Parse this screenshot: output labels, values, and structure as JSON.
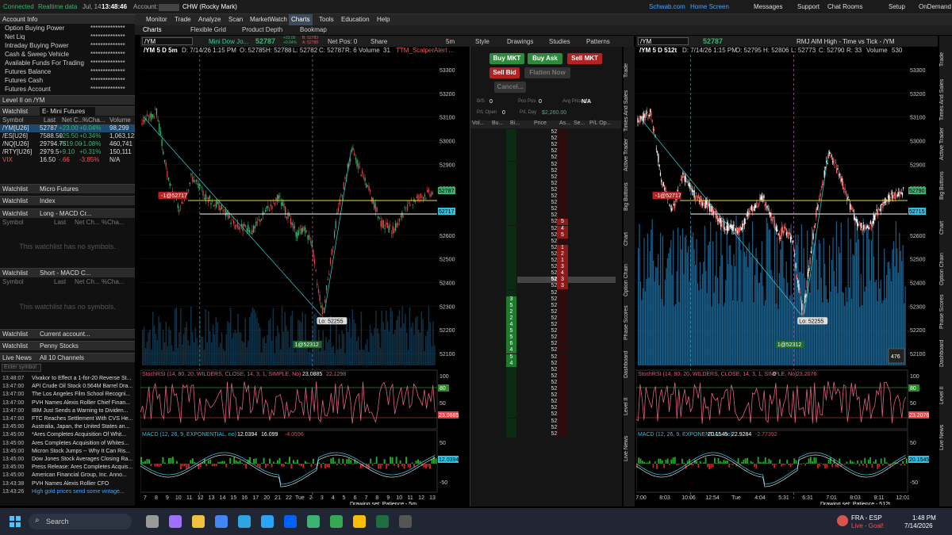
{
  "status": {
    "connected": "Connected",
    "realtime": "Realtime data",
    "date": "Jul, 14",
    "time": "13:48:46",
    "account_label": "Account:",
    "account_value": "CHW (Rocky Mark)"
  },
  "topright": {
    "schwab": "Schwab.com",
    "home": "Home Screen",
    "messages": "Messages",
    "support": "Support",
    "chat": "Chat Rooms",
    "setup": "Setup",
    "ondemand": "OnDemand"
  },
  "menu": [
    "Monitor",
    "Trade",
    "Analyze",
    "Scan",
    "MarketWatch",
    "Charts",
    "Tools",
    "Education",
    "Help"
  ],
  "subtabs": [
    "Charts",
    "Flexible Grid",
    "Product Depth",
    "Bookmap"
  ],
  "account_info": {
    "title": "Account Info",
    "rows": [
      "Option Buying Power",
      "Net Liq",
      "Intraday Buying Power",
      "Cash & Sweep Vehicle",
      "Available Funds For Trading",
      "Futures Balance",
      "Futures Cash",
      "Futures Account"
    ],
    "mask": "**************"
  },
  "level2": "Level II on /YM",
  "watchlist": {
    "label": "Watchlist",
    "name": "E- Mini Futures",
    "headers": [
      "Symbol",
      "Last",
      "Net C...",
      "%Cha...",
      "Volume"
    ],
    "rows": [
      [
        "/YM[U26]",
        "52787",
        "+23.00",
        "+0.04%",
        "98,299"
      ],
      [
        "/ES[U26]",
        "7588.50",
        "+25.50",
        "+0.34%",
        "1,063,123"
      ],
      [
        "/NQ[U26]",
        "29794.75",
        "+319.00",
        "+1.08%",
        "460,741"
      ],
      [
        "/RTY[U26]",
        "2979.5",
        "+9.10",
        "+0.31%",
        "150,111"
      ],
      [
        "VIX",
        "16.50",
        "-.66",
        "-3.85%",
        "N/A"
      ]
    ]
  },
  "wl_micro": "Micro Futures",
  "wl_index": "Index",
  "wl_long": "Long - MACD Cr...",
  "wl_short": "Short - MACD C...",
  "wl_current": "Current account...",
  "wl_penny": "Penny Stocks",
  "empty_wl": "This watchlist has no symbols.",
  "wl_headers2": [
    "Symbol",
    "Last",
    "Net Ch...",
    "%Cha..."
  ],
  "news": {
    "title": "Live News",
    "channels": "All 10 Channels",
    "placeholder": "Enter symbol",
    "items": [
      [
        "13:48:07",
        "Vivakor to Effect a 1-for-20 Reverse St..."
      ],
      [
        "13:47:00",
        "API Crude Oil Stock 0.564M Barrel Dra..."
      ],
      [
        "13:47:00",
        "The Los Angeles Film School Recogni..."
      ],
      [
        "13:47:00",
        "PVH Names Alexis Rollier Chief Finan..."
      ],
      [
        "13:47:00",
        "IBM Just Sends a Warning to Dividen..."
      ],
      [
        "13:47:00",
        "FTC Reaches Settlement With CVS He..."
      ],
      [
        "13:45:00",
        "Australia, Japan, the United States an..."
      ],
      [
        "13:45:00",
        "*Ares Completes Acquisition Of Whit..."
      ],
      [
        "13:45:00",
        "Ares Completes Acquisition of Whites..."
      ],
      [
        "13:45:00",
        "Micron Stock Jumps -- Why It Can Ris..."
      ],
      [
        "13:45:00",
        "Dow Jones Stock Averages Closing Ra..."
      ],
      [
        "13:45:00",
        "Press Release: Ares Completes Acquis..."
      ],
      [
        "13:45:00",
        "American Financial Group, Inc. Anno..."
      ],
      [
        "13:43:38",
        "PVH Names Alexis Rollier CFO"
      ],
      [
        "13:43:26",
        "High gold prices send some vintage..."
      ]
    ]
  },
  "chart1": {
    "symbol": "/YM",
    "product": "Mini Dow Jo...",
    "price": "52787",
    "chg": "+23.00",
    "chgp": "+0.04%",
    "bid": "B: 52783",
    "ask": "A: 52788",
    "netpos": "Net Pos: 0",
    "share": "Share",
    "tf": "5m",
    "style": "Style",
    "drawings": "Drawings",
    "studies": "Studies",
    "patterns": "Patterns",
    "header": [
      "/YM 5 D 5m",
      "D: 7/14/26 1:15 PM",
      "O: 52785",
      "H: 52788",
      "L: 52782",
      "C: 52787",
      "R: 6",
      "Volume",
      "31",
      "TTM_ScalperAlert ..."
    ],
    "yticks": [
      "53300",
      "53200",
      "53100",
      "53000",
      "52900",
      "52800",
      "52700",
      "52600",
      "52500",
      "52400",
      "52300",
      "52200",
      "52100"
    ],
    "xticks": [
      "7",
      "8",
      "9",
      "10",
      "11",
      "12",
      "13",
      "14",
      "15",
      "16",
      "17",
      "20",
      "21",
      "22",
      "Tue",
      "2",
      "3",
      "4",
      "5",
      "6",
      "7",
      "8",
      "9",
      "10",
      "11",
      "12",
      "13"
    ],
    "tag_last": "52787",
    "tag_bid": "52717",
    "label_entry": "-1@52717",
    "label_low": "Lo: 52255",
    "label_fill": "1@52312",
    "stoch": [
      "StochRSI (14, 80, 20, WILDERS, CLOSE, 14, 3, 1, SIMPLE, No)",
      "23.0885",
      "22.1298",
      "80",
      "20"
    ],
    "stoch_ticks": [
      "100",
      "50"
    ],
    "stoch_tag": "23.0885",
    "stoch_80": "80",
    "macd": [
      "MACD (12, 26, 9, EXPONENTIAL, no)",
      "12.0394",
      "16.099",
      "-4.0596",
      "0"
    ],
    "macd_ticks": [
      "50",
      "-50"
    ],
    "macd_tag": "12.0394",
    "drawing_set": "Drawing set: Patience - 5m"
  },
  "trader": {
    "buy_mkt": "Buy MKT",
    "buy_ask": "Buy Ask",
    "sell_mkt": "Sell MKT",
    "sell_bid": "Sell Bid",
    "flatten": "Flatten Now",
    "cancel": "Cancel...",
    "bs_label": "B/S",
    "bs_val": "0",
    "pos_label": "Pos Pos",
    "pos_val": "0",
    "avg_label": "Avg Price",
    "avg_val": "N/A",
    "pl_open_label": "P/L Open",
    "pl_open_val": "0",
    "pl_day_label": "P/L Day",
    "pl_day_val": "$2,260.00",
    "cols": [
      "Vol...",
      "Bu...",
      "Bi...",
      "Price",
      "As...",
      "Se...",
      "P/L Op..."
    ],
    "prices": [
      "52810",
      "52809",
      "52808",
      "52807",
      "52806",
      "52805",
      "52804",
      "52803",
      "52802",
      "52801",
      "52800",
      "52799",
      "52798",
      "52797",
      "52796",
      "52795",
      "52794",
      "52793",
      "52792",
      "52791",
      "52790",
      "52789",
      "52788",
      "52787",
      "52786",
      "52785",
      "52784",
      "52783",
      "52782",
      "52781",
      "52780",
      "52779",
      "52778",
      "52777",
      "52776",
      "52775",
      "52774",
      "52773",
      "52772",
      "52771",
      "52770",
      "52769",
      "52768",
      "52767",
      "52766",
      "52765",
      "52764",
      "52763"
    ],
    "asks": {
      "52796": "5",
      "52795": "4",
      "52794": "5",
      "52792": "1",
      "52791": "2",
      "52790": "1",
      "52789": "3",
      "52788": "4",
      "52787": "3",
      "52786": "3"
    },
    "bids": {
      "52784": "3",
      "52783": "5",
      "52782": "2",
      "52781": "2",
      "52780": "4",
      "52779": "5",
      "52778": "5",
      "52777": "6",
      "52776": "4",
      "52775": "5",
      "52774": "4"
    }
  },
  "chart2": {
    "symbol": "/YM",
    "price": "52787",
    "title": "RMJ AIM High - Time vs Tick - /YM",
    "tf": "512t",
    "header": [
      "/YM 5 D 512t",
      "D: 7/14/26 1:15 PM",
      "O: 52795",
      "H: 52806",
      "L: 52773",
      "C: 52790",
      "R: 33",
      "Volume",
      "530"
    ],
    "yticks": [
      "53300",
      "53200",
      "53100",
      "53000",
      "52900",
      "52800",
      "52700",
      "52600",
      "52500",
      "52400",
      "52300",
      "52200",
      "52100"
    ],
    "xticks": [
      "7:00",
      "8:03",
      "10:06",
      "12:54",
      "Tue",
      "4:04",
      "5:31",
      "6:31",
      "7:01",
      "8:03",
      "9:11",
      "12:01"
    ],
    "tag_last": "52790",
    "tag_bid": "52715",
    "label_entry": "-1@52717",
    "label_low": "Lo: 52255",
    "label_fill": "1@52312",
    "count": "476",
    "stoch": [
      "StochRSI (14, 80, 20, WILDERS, CLOSE, 14, 3, 1, SIMPLE, No)",
      "0",
      "23.2076",
      "80",
      "20"
    ],
    "stoch_ticks": [
      "100",
      "50"
    ],
    "stoch_tag": "23.2076",
    "stoch_80": "80",
    "macd": [
      "MACD (12, 26, 9, EXPONENTIAL, no)",
      "20.1545",
      "22.9284",
      "-2.77392",
      "0"
    ],
    "macd_ticks": [
      "50",
      "-50"
    ],
    "macd_tag": "20.1545",
    "drawing_set": "Drawing set: Patience - 512t"
  },
  "sidetabs1": [
    "Trade",
    "Times And Sales",
    "Active Trader",
    "Big Buttons",
    "Chart",
    "Option Chain",
    "Phase Scores",
    "Dashboard",
    "Level II",
    "Live News"
  ],
  "sidetabs2": [
    "Trade",
    "Times And Sales",
    "Active Trader",
    "Big Buttons",
    "Chart",
    "Option Chain",
    "Phase Scores",
    "Dashboard",
    "Level II",
    "Live News"
  ],
  "taskbar": {
    "search": "Search",
    "weather_title": "FRA - ESP",
    "weather_sub": "Live - Goal!",
    "clock": "1:48 PM",
    "date": "7/14/2026"
  }
}
